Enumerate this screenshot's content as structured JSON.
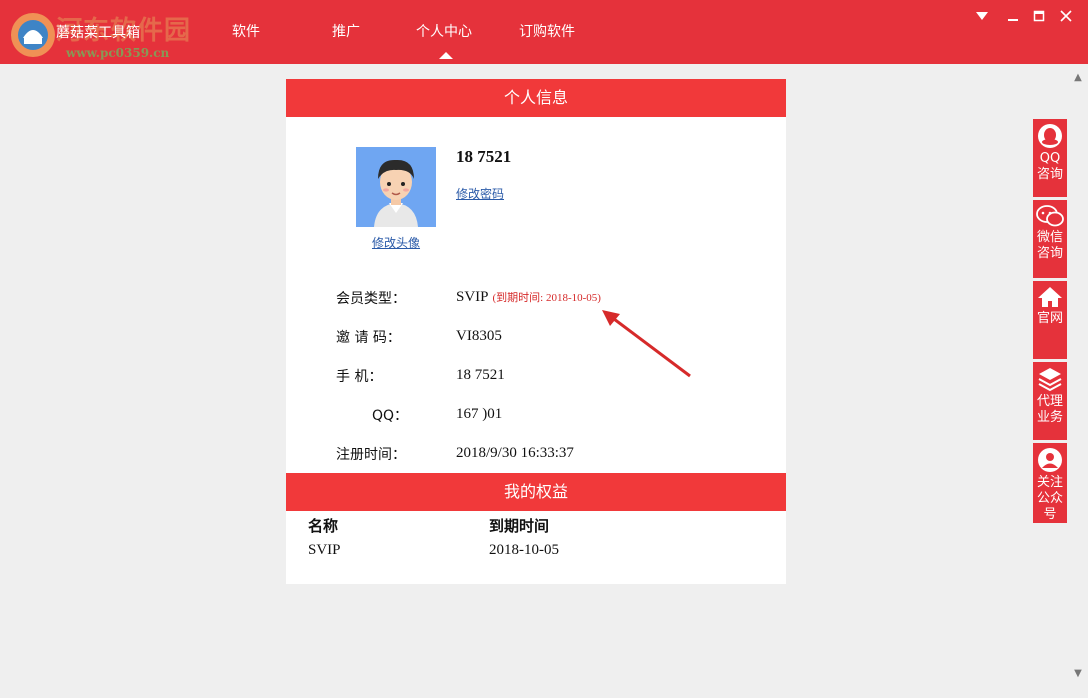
{
  "app": {
    "name": "蘑菇菜工具箱",
    "watermark": "河东软件园",
    "watermark_url": "www.pc0359.cn"
  },
  "nav": {
    "items": [
      "软件",
      "推广",
      "个人中心",
      "订购软件"
    ],
    "active": "个人中心"
  },
  "window_controls": [
    "dropdown",
    "minimize",
    "maximize",
    "close"
  ],
  "profile": {
    "section_title": "个人信息",
    "username": "18      7521",
    "change_password": "修改密码",
    "change_avatar": "修改头像",
    "rows": [
      {
        "label": "会员类型：",
        "value": "SVIP",
        "expire": "(到期时间: 2018-10-05)"
      },
      {
        "label": "邀  请  码：",
        "value": "VI8305"
      },
      {
        "label": "手      机：",
        "value": "18      7521"
      },
      {
        "label": "QQ：",
        "value": "167      )01"
      },
      {
        "label": "注册时间：",
        "value": "2018/9/30 16:33:37"
      }
    ]
  },
  "rights": {
    "section_title": "我的权益",
    "headers": [
      "名称",
      "到期时间"
    ],
    "rows": [
      [
        "SVIP",
        "2018-10-05"
      ]
    ]
  },
  "sidebar": [
    {
      "icon": "qq-icon",
      "label": "QQ\n咨询"
    },
    {
      "icon": "wechat-icon",
      "label": "微信\n咨询"
    },
    {
      "icon": "home-icon",
      "label": "官网"
    },
    {
      "icon": "layers-icon",
      "label": "代理\n业务"
    },
    {
      "icon": "user-icon",
      "label": "关注\n公众\n号"
    }
  ],
  "colors": {
    "brand_red": "#e5323b",
    "header_red": "#f1393a",
    "link_blue": "#2a5aa8",
    "expire_red": "#d62a2a",
    "annotation_arrow": "#d62a2a"
  }
}
